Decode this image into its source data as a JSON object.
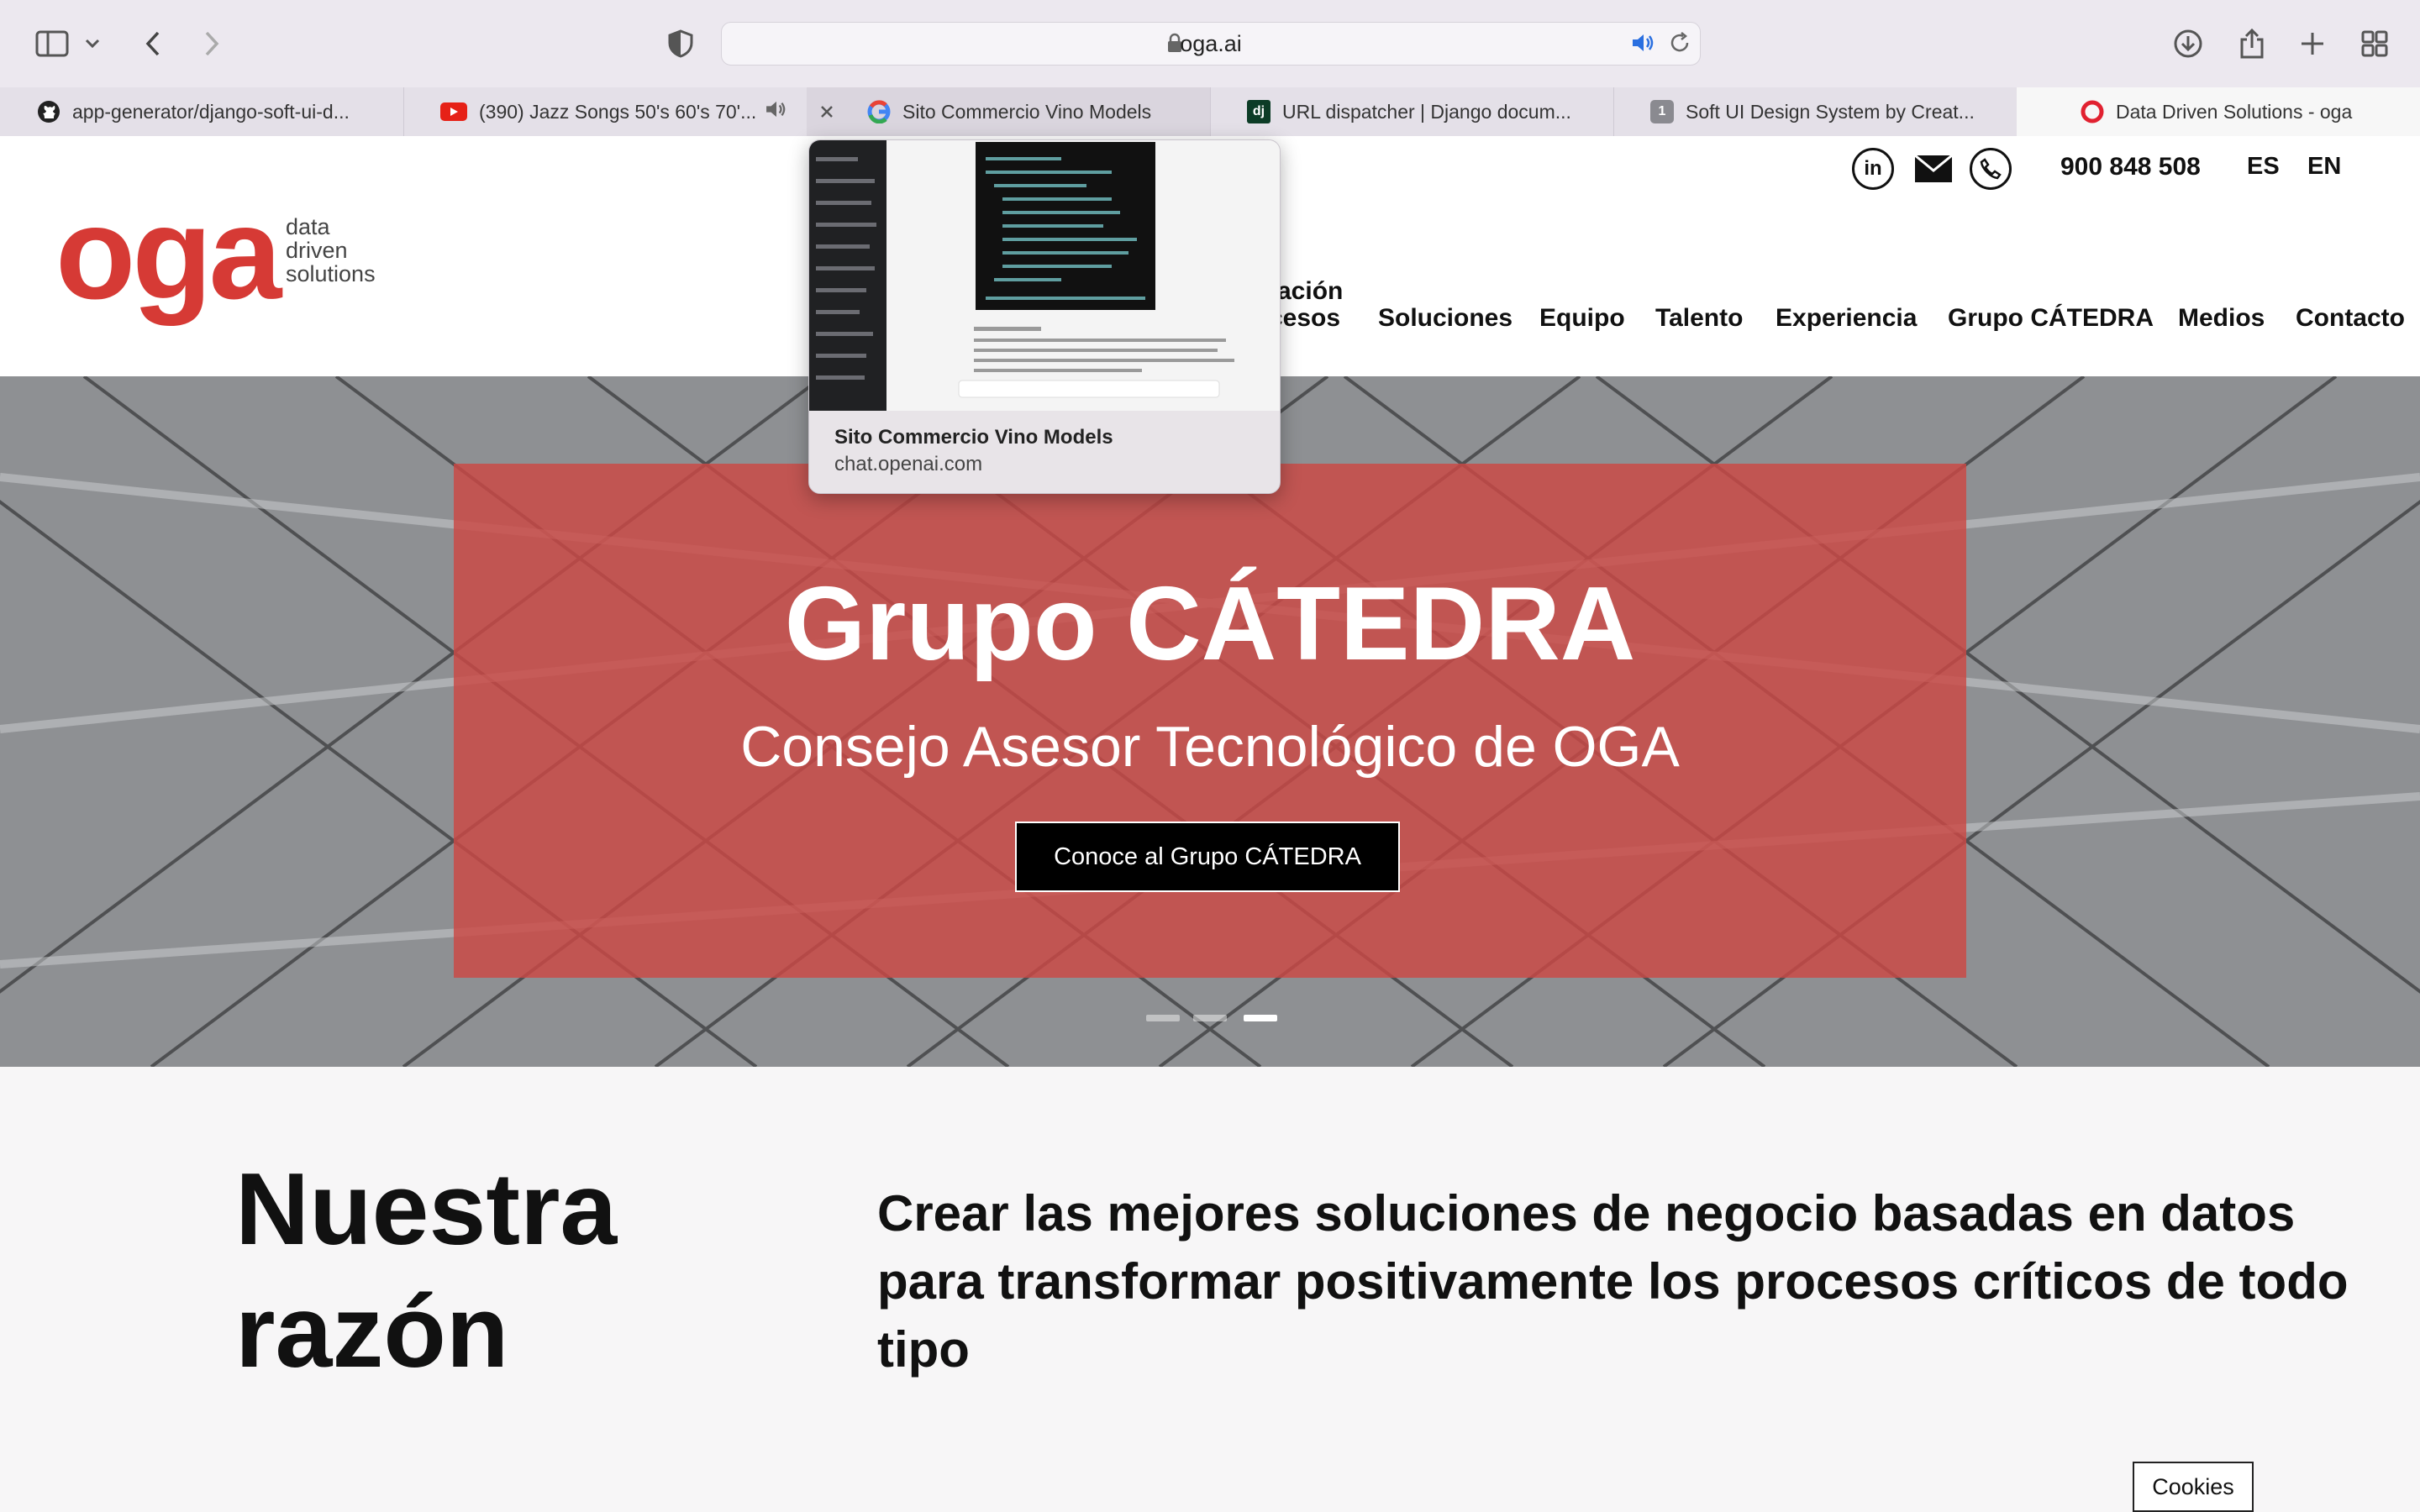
{
  "browser": {
    "url": "oga.ai",
    "tabs": [
      {
        "label": "app-generator/django-soft-ui-d...",
        "icon": "github-icon"
      },
      {
        "label": "(390) Jazz Songs 50's 60's 70'...",
        "icon": "youtube-icon"
      },
      {
        "label": "Sito Commercio Vino Models",
        "icon": "google-icon"
      },
      {
        "label": "URL dispatcher | Django docum...",
        "icon": "django-icon"
      },
      {
        "label": "Soft UI Design System by Creat...",
        "icon": "number-one-icon",
        "fav_text": "1"
      },
      {
        "label": "Data Driven Solutions - oga",
        "icon": "opera-icon"
      }
    ],
    "preview": {
      "title": "Sito Commercio Vino Models",
      "url": "chat.openai.com"
    }
  },
  "site": {
    "brand": {
      "name": "oga",
      "tagline_1": "data",
      "tagline_2": "driven",
      "tagline_3": "solutions"
    },
    "phone": "900 848 508",
    "lang_es": "ES",
    "lang_en": "EN",
    "nav_partial_1": "tación",
    "nav_partial_2": "cesos",
    "nav": [
      "Soluciones",
      "Equipo",
      "Talento",
      "Experiencia",
      "Grupo CÁTEDRA",
      "Medios",
      "Contacto"
    ],
    "hero": {
      "title": "Grupo CÁTEDRA",
      "subtitle": "Consejo Asesor Tecnológico de OGA",
      "button": "Conoce al Grupo CÁTEDRA"
    },
    "reason": {
      "title": "Nuestra razón",
      "text": "Crear las mejores soluciones de negocio basadas en datos para transformar positivamente los procesos críticos de todo tipo"
    },
    "cookies": "Cookies"
  },
  "colors": {
    "brand_red": "#d63a35",
    "hero_overlay": "#cc4844"
  }
}
